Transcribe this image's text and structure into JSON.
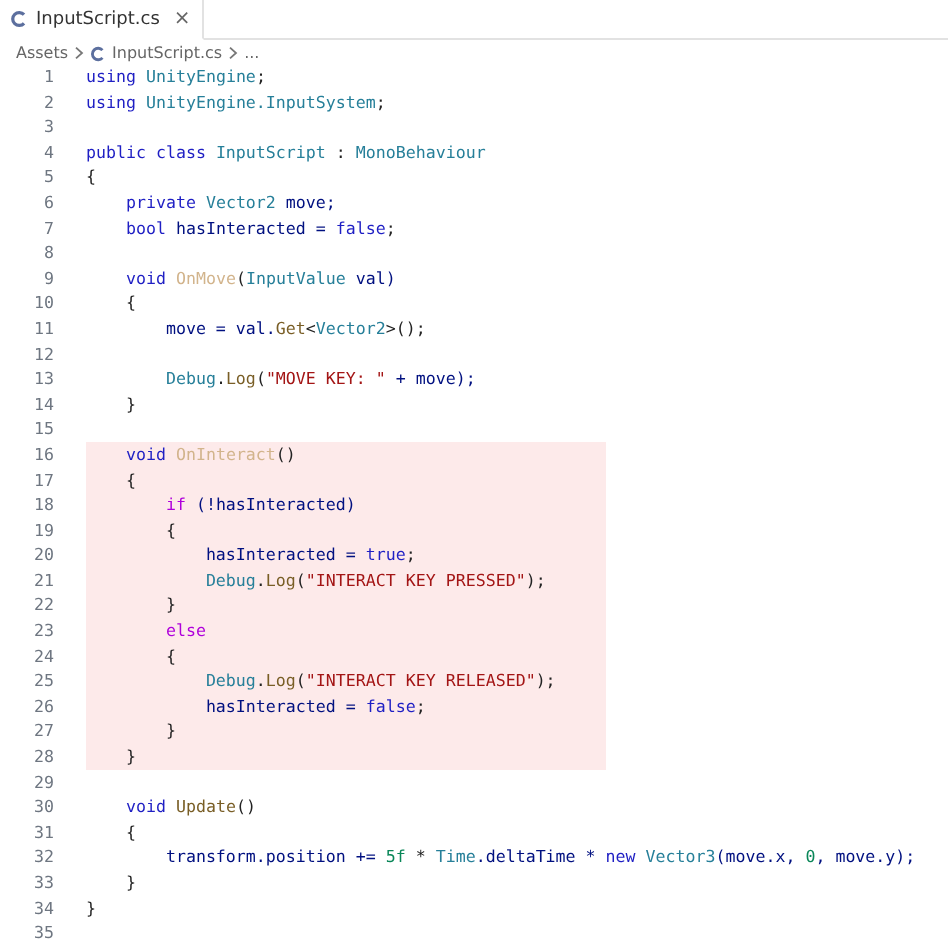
{
  "tabs": [
    {
      "label": "InputScript.cs",
      "close": "×",
      "selected": true
    }
  ],
  "breadcrumb": [
    "Assets",
    "InputScript.cs",
    "..."
  ],
  "lines": [
    {
      "number": "1",
      "highlighted": false,
      "tokens": [
        {
          "text": "using ",
          "kind": "keyword"
        },
        {
          "text": "UnityEngine",
          "kind": "type"
        },
        {
          "text": ";",
          "kind": "plain"
        }
      ]
    },
    {
      "number": "2",
      "highlighted": false,
      "tokens": [
        {
          "text": "using ",
          "kind": "keyword"
        },
        {
          "text": "UnityEngine.InputSystem",
          "kind": "type"
        },
        {
          "text": ";",
          "kind": "plain"
        }
      ]
    },
    {
      "number": "3",
      "highlighted": false
    },
    {
      "number": "4",
      "highlighted": false,
      "tokens": [
        {
          "text": "public class ",
          "kind": "keyword"
        },
        {
          "text": "InputScript",
          "kind": "type"
        },
        {
          "text": " : ",
          "kind": "plain"
        },
        {
          "text": "MonoBehaviour",
          "kind": "type"
        }
      ]
    },
    {
      "number": "5",
      "highlighted": false,
      "tokens": [
        {
          "text": "{",
          "kind": "plain"
        }
      ]
    },
    {
      "number": "6",
      "highlighted": false,
      "tokens": [
        {
          "text": "    private ",
          "kind": "keyword"
        },
        {
          "text": "Vector2",
          "kind": "type"
        },
        {
          "text": " move;",
          "kind": "variable"
        }
      ]
    },
    {
      "number": "7",
      "highlighted": false,
      "tokens": [
        {
          "text": "    bool",
          "kind": "keyword"
        },
        {
          "text": " hasInteracted = ",
          "kind": "variable"
        },
        {
          "text": "false",
          "kind": "keyword"
        },
        {
          "text": ";",
          "kind": "plain"
        }
      ]
    },
    {
      "number": "8",
      "highlighted": false
    },
    {
      "number": "9",
      "highlighted": false,
      "tokens": [
        {
          "text": "    void ",
          "kind": "keyword"
        },
        {
          "text": "OnMove",
          "kind": "unused-method"
        },
        {
          "text": "(",
          "kind": "plain"
        },
        {
          "text": "InputValue",
          "kind": "type"
        },
        {
          "text": " val)",
          "kind": "variable"
        }
      ]
    },
    {
      "number": "10",
      "highlighted": false,
      "tokens": [
        {
          "text": "    {",
          "kind": "plain"
        }
      ]
    },
    {
      "number": "11",
      "highlighted": false,
      "tokens": [
        {
          "text": "        move = val.",
          "kind": "variable"
        },
        {
          "text": "Get",
          "kind": "method"
        },
        {
          "text": "<",
          "kind": "plain"
        },
        {
          "text": "Vector2",
          "kind": "type"
        },
        {
          "text": ">();",
          "kind": "plain"
        }
      ]
    },
    {
      "number": "12",
      "highlighted": false
    },
    {
      "number": "13",
      "highlighted": false,
      "tokens": [
        {
          "text": "        Debug",
          "kind": "type"
        },
        {
          "text": ".",
          "kind": "plain"
        },
        {
          "text": "Log",
          "kind": "method"
        },
        {
          "text": "(",
          "kind": "plain"
        },
        {
          "text": "\"MOVE KEY: \"",
          "kind": "string"
        },
        {
          "text": " + move);",
          "kind": "variable"
        }
      ]
    },
    {
      "number": "14",
      "highlighted": false,
      "tokens": [
        {
          "text": "    }",
          "kind": "plain"
        }
      ]
    },
    {
      "number": "15",
      "highlighted": false
    },
    {
      "number": "16",
      "highlighted": true,
      "tokens": [
        {
          "text": "    void ",
          "kind": "keyword"
        },
        {
          "text": "OnInteract",
          "kind": "unused-method"
        },
        {
          "text": "()",
          "kind": "plain"
        }
      ]
    },
    {
      "number": "17",
      "highlighted": true,
      "tokens": [
        {
          "text": "    {",
          "kind": "plain"
        }
      ]
    },
    {
      "number": "18",
      "highlighted": true,
      "tokens": [
        {
          "text": "        if",
          "kind": "control"
        },
        {
          "text": " (!hasInteracted)",
          "kind": "variable"
        }
      ]
    },
    {
      "number": "19",
      "highlighted": true,
      "tokens": [
        {
          "text": "        {",
          "kind": "plain"
        }
      ]
    },
    {
      "number": "20",
      "highlighted": true,
      "tokens": [
        {
          "text": "            hasInteracted = ",
          "kind": "variable"
        },
        {
          "text": "true",
          "kind": "keyword"
        },
        {
          "text": ";",
          "kind": "plain"
        }
      ]
    },
    {
      "number": "21",
      "highlighted": true,
      "tokens": [
        {
          "text": "            Debug",
          "kind": "type"
        },
        {
          "text": ".",
          "kind": "plain"
        },
        {
          "text": "Log",
          "kind": "method"
        },
        {
          "text": "(",
          "kind": "plain"
        },
        {
          "text": "\"INTERACT KEY PRESSED\"",
          "kind": "string"
        },
        {
          "text": ");",
          "kind": "plain"
        }
      ]
    },
    {
      "number": "22",
      "highlighted": true,
      "tokens": [
        {
          "text": "        }",
          "kind": "plain"
        }
      ]
    },
    {
      "number": "23",
      "highlighted": true,
      "tokens": [
        {
          "text": "        else",
          "kind": "control"
        }
      ]
    },
    {
      "number": "24",
      "highlighted": true,
      "tokens": [
        {
          "text": "        {",
          "kind": "plain"
        }
      ]
    },
    {
      "number": "25",
      "highlighted": true,
      "tokens": [
        {
          "text": "            Debug",
          "kind": "type"
        },
        {
          "text": ".",
          "kind": "plain"
        },
        {
          "text": "Log",
          "kind": "method"
        },
        {
          "text": "(",
          "kind": "plain"
        },
        {
          "text": "\"INTERACT KEY RELEASED\"",
          "kind": "string"
        },
        {
          "text": ");",
          "kind": "plain"
        }
      ]
    },
    {
      "number": "26",
      "highlighted": true,
      "tokens": [
        {
          "text": "            hasInteracted = ",
          "kind": "variable"
        },
        {
          "text": "false",
          "kind": "keyword"
        },
        {
          "text": ";",
          "kind": "plain"
        }
      ]
    },
    {
      "number": "27",
      "highlighted": true,
      "tokens": [
        {
          "text": "        }",
          "kind": "plain"
        }
      ]
    },
    {
      "number": "28",
      "highlighted": true,
      "tokens": [
        {
          "text": "    }",
          "kind": "plain"
        }
      ]
    },
    {
      "number": "29",
      "highlighted": false
    },
    {
      "number": "30",
      "highlighted": false,
      "tokens": [
        {
          "text": "    void ",
          "kind": "keyword"
        },
        {
          "text": "Update",
          "kind": "method"
        },
        {
          "text": "()",
          "kind": "plain"
        }
      ]
    },
    {
      "number": "31",
      "highlighted": false,
      "tokens": [
        {
          "text": "    {",
          "kind": "plain"
        }
      ]
    },
    {
      "number": "32",
      "highlighted": false,
      "tokens": [
        {
          "text": "        transform.position += ",
          "kind": "variable"
        },
        {
          "text": "5f",
          "kind": "number"
        },
        {
          "text": " * ",
          "kind": "plain"
        },
        {
          "text": "Time",
          "kind": "type"
        },
        {
          "text": ".deltaTime * ",
          "kind": "variable"
        },
        {
          "text": "new ",
          "kind": "keyword"
        },
        {
          "text": "Vector3",
          "kind": "type"
        },
        {
          "text": "(move.x, ",
          "kind": "variable"
        },
        {
          "text": "0",
          "kind": "number"
        },
        {
          "text": ", move.y);",
          "kind": "variable"
        }
      ]
    },
    {
      "number": "33",
      "highlighted": false,
      "tokens": [
        {
          "text": "    }",
          "kind": "plain"
        }
      ]
    },
    {
      "number": "34",
      "highlighted": false,
      "tokens": [
        {
          "text": "}",
          "kind": "plain"
        }
      ]
    },
    {
      "number": "35",
      "highlighted": false
    }
  ]
}
